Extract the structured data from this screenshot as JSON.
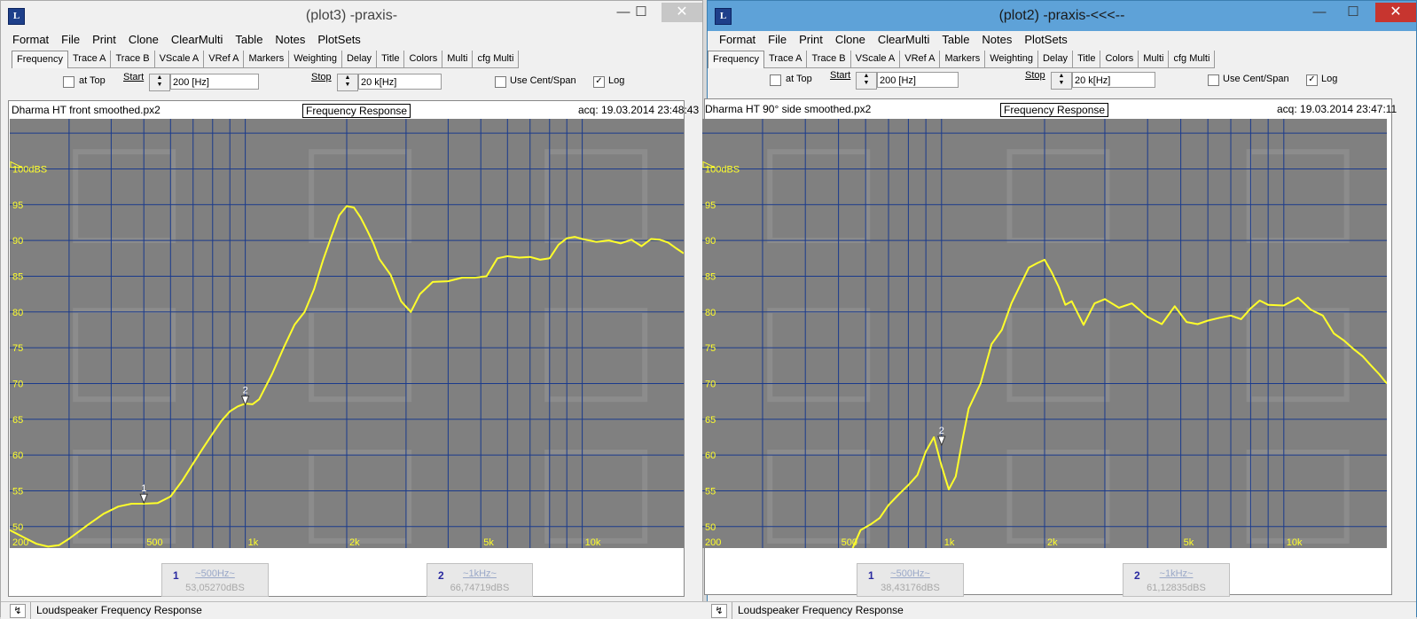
{
  "windows": [
    {
      "title": "(plot3) -praxis-",
      "app_icon": "L",
      "menu": [
        "Format",
        "File",
        "Print",
        "Clone",
        "ClearMulti",
        "Table",
        "Notes",
        "PlotSets"
      ],
      "tabs": [
        "Frequency",
        "Trace A",
        "Trace B",
        "VScale A",
        "VRef A",
        "Markers",
        "Weighting",
        "Delay",
        "Title",
        "Colors",
        "Multi",
        "cfg Multi"
      ],
      "active_tab": "Frequency",
      "controls": {
        "at_top_label": "at Top",
        "at_top_checked": false,
        "start_label": "Start",
        "start_value": "200 [Hz]",
        "stop_label": "Stop",
        "stop_value": "20 k[Hz]",
        "use_cent_span_label": "Use Cent/Span",
        "use_cent_span_checked": false,
        "log_label": "Log",
        "log_checked": true
      },
      "header": {
        "file": "Dharma HT front smoothed.px2",
        "center": "Frequency Response",
        "acq": "acq: 19.03.2014 23:48:43"
      },
      "markers": [
        {
          "num": "1",
          "freq": "~500Hz~",
          "value": "53,05270dBS"
        },
        {
          "num": "2",
          "freq": "~1kHz~",
          "value": "66,74719dBS"
        }
      ],
      "status_text": "Loudspeaker Frequency Response"
    },
    {
      "title": "(plot2) -praxis-<<<--",
      "app_icon": "L",
      "menu": [
        "Format",
        "File",
        "Print",
        "Clone",
        "ClearMulti",
        "Table",
        "Notes",
        "PlotSets"
      ],
      "tabs": [
        "Frequency",
        "Trace A",
        "Trace B",
        "VScale A",
        "VRef A",
        "Markers",
        "Weighting",
        "Delay",
        "Title",
        "Colors",
        "Multi",
        "cfg Multi"
      ],
      "active_tab": "Frequency",
      "controls": {
        "at_top_label": "at Top",
        "at_top_checked": false,
        "start_label": "Start",
        "start_value": "200 [Hz]",
        "stop_label": "Stop",
        "stop_value": "20 k[Hz]",
        "use_cent_span_label": "Use Cent/Span",
        "use_cent_span_checked": false,
        "log_label": "Log",
        "log_checked": true
      },
      "header": {
        "file": "Dharma HT 90° side smoothed.px2",
        "center": "Frequency Response",
        "acq": "acq: 19.03.2014 23:47:11"
      },
      "markers": [
        {
          "num": "1",
          "freq": "~500Hz~",
          "value": "38,43176dBS"
        },
        {
          "num": "2",
          "freq": "~1kHz~",
          "value": "61,12835dBS"
        }
      ],
      "status_text": "Loudspeaker Frequency Response"
    }
  ],
  "chart_data": [
    {
      "type": "line",
      "xscale": "log",
      "xlim": [
        200,
        20000
      ],
      "ylim": [
        47,
        107
      ],
      "y_ticks": [
        50,
        55,
        60,
        65,
        70,
        75,
        80,
        85,
        90,
        95
      ],
      "y_top_label": "100dBS",
      "x_tick_labels": [
        {
          "x": 200,
          "label": "200"
        },
        {
          "x": 500,
          "label": "500"
        },
        {
          "x": 1000,
          "label": "1k"
        },
        {
          "x": 2000,
          "label": "2k"
        },
        {
          "x": 5000,
          "label": "5k"
        },
        {
          "x": 10000,
          "label": "10k"
        }
      ],
      "grid": true,
      "line_color": "#ffff2a",
      "plot_background": "#808080",
      "grid_color": "#1a3a8c",
      "x": [
        200,
        220,
        240,
        260,
        280,
        300,
        340,
        380,
        420,
        460,
        500,
        550,
        600,
        650,
        700,
        750,
        800,
        850,
        900,
        950,
        1000,
        1050,
        1100,
        1200,
        1300,
        1400,
        1500,
        1600,
        1700,
        1800,
        1900,
        2000,
        2100,
        2200,
        2300,
        2400,
        2500,
        2700,
        2900,
        3100,
        3300,
        3600,
        4000,
        4400,
        4800,
        5200,
        5600,
        6000,
        6500,
        7000,
        7500,
        8000,
        8500,
        9000,
        9500,
        10000,
        11000,
        12000,
        13000,
        14000,
        15000,
        16000,
        17000,
        18000,
        19000,
        20000
      ],
      "y": [
        49.5,
        48.5,
        47.6,
        47.2,
        47.4,
        48.3,
        50.2,
        51.8,
        52.8,
        53.2,
        53.2,
        53.3,
        54.2,
        56.4,
        58.8,
        61.0,
        63.0,
        64.8,
        66.1,
        66.8,
        67.2,
        67.1,
        67.8,
        71.3,
        75.0,
        78.2,
        80.0,
        83.2,
        87.2,
        90.5,
        93.5,
        94.8,
        94.6,
        93.2,
        91.4,
        89.6,
        87.4,
        85.2,
        81.5,
        80.0,
        82.5,
        84.2,
        84.3,
        84.8,
        84.8,
        85.0,
        87.5,
        87.8,
        87.6,
        87.7,
        87.3,
        87.5,
        89.4,
        90.3,
        90.5,
        90.2,
        89.8,
        90.0,
        89.6,
        90.1,
        89.2,
        90.2,
        90.1,
        89.7,
        88.9,
        88.2
      ],
      "markers": [
        {
          "x": 500,
          "y": 53.05,
          "label": "1"
        },
        {
          "x": 1000,
          "y": 66.75,
          "label": "2"
        }
      ]
    },
    {
      "type": "line",
      "xscale": "log",
      "xlim": [
        200,
        20000
      ],
      "ylim": [
        47,
        107
      ],
      "y_ticks": [
        50,
        55,
        60,
        65,
        70,
        75,
        80,
        85,
        90,
        95
      ],
      "y_top_label": "100dBS",
      "x_tick_labels": [
        {
          "x": 200,
          "label": "200"
        },
        {
          "x": 500,
          "label": "500"
        },
        {
          "x": 1000,
          "label": "1k"
        },
        {
          "x": 2000,
          "label": "2k"
        },
        {
          "x": 5000,
          "label": "5k"
        },
        {
          "x": 10000,
          "label": "10k"
        }
      ],
      "grid": true,
      "line_color": "#ffff2a",
      "plot_background": "#808080",
      "grid_color": "#1a3a8c",
      "x": [
        550,
        580,
        620,
        660,
        700,
        750,
        800,
        850,
        900,
        950,
        1000,
        1050,
        1100,
        1150,
        1200,
        1300,
        1400,
        1500,
        1600,
        1700,
        1800,
        1900,
        2000,
        2100,
        2200,
        2300,
        2400,
        2600,
        2800,
        3000,
        3300,
        3600,
        4000,
        4400,
        4800,
        5200,
        5600,
        6000,
        6500,
        7000,
        7500,
        8000,
        8500,
        9000,
        10000,
        11000,
        12000,
        13000,
        14000,
        15000,
        16000,
        17000,
        18000,
        19000,
        20000
      ],
      "y": [
        47.0,
        49.5,
        50.3,
        51.2,
        53.0,
        54.5,
        55.8,
        57.2,
        60.5,
        62.5,
        58.5,
        55.2,
        57.0,
        62.0,
        66.5,
        70.0,
        75.5,
        77.5,
        81.2,
        83.8,
        86.2,
        86.8,
        87.3,
        85.5,
        83.5,
        81.0,
        81.5,
        78.2,
        81.2,
        81.8,
        80.6,
        81.2,
        79.3,
        78.3,
        80.8,
        78.6,
        78.3,
        78.8,
        79.2,
        79.5,
        79.0,
        80.5,
        81.6,
        81.0,
        80.9,
        82.0,
        80.3,
        79.5,
        77.0,
        76.0,
        74.8,
        73.8,
        72.5,
        71.3,
        70.0
      ],
      "markers": [
        {
          "x": 1000,
          "y": 61.13,
          "label": "2"
        }
      ]
    }
  ]
}
